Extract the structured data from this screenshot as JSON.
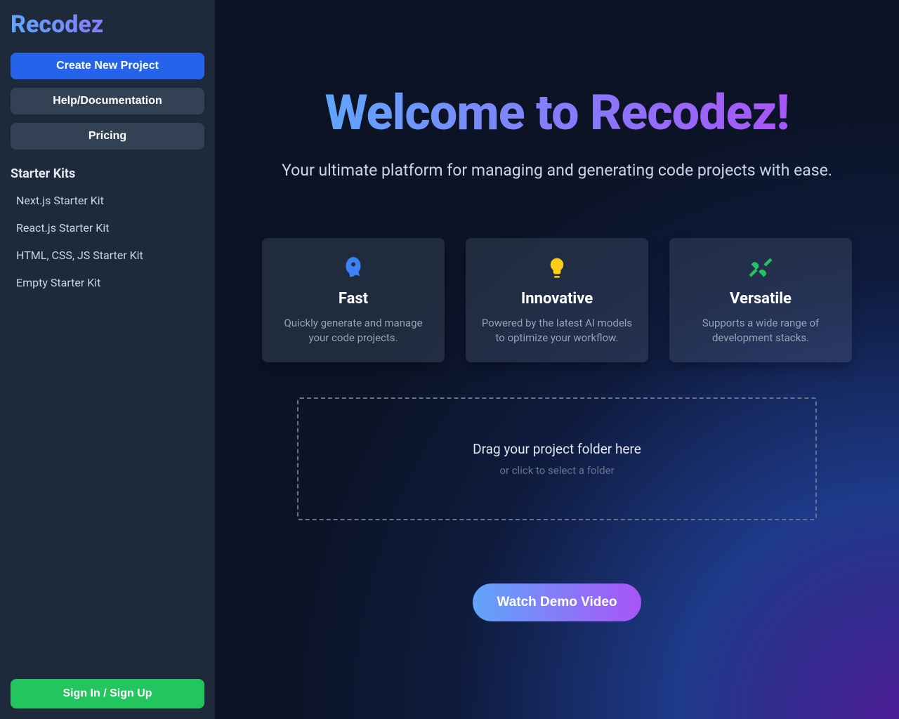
{
  "app": {
    "name": "Recodez"
  },
  "sidebar": {
    "create": "Create New Project",
    "help": "Help/Documentation",
    "pricing": "Pricing",
    "starter_title": "Starter Kits",
    "kits": [
      "Next.js Starter Kit",
      "React.js Starter Kit",
      "HTML, CSS, JS Starter Kit",
      "Empty Starter Kit"
    ],
    "signin": "Sign In / Sign Up"
  },
  "hero": {
    "title": "Welcome to Recodez!",
    "subtitle": "Your ultimate platform for managing and generating code projects with ease."
  },
  "features": [
    {
      "title": "Fast",
      "desc": "Quickly generate and manage your code projects.",
      "icon": "rocket-icon",
      "color": "#3b82f6"
    },
    {
      "title": "Innovative",
      "desc": "Powered by the latest AI models to optimize your workflow.",
      "icon": "lightbulb-icon",
      "color": "#facc15"
    },
    {
      "title": "Versatile",
      "desc": "Supports a wide range of development stacks.",
      "icon": "tools-icon",
      "color": "#22c55e"
    }
  ],
  "dropzone": {
    "main": "Drag your project folder here",
    "sub": "or click to select a folder"
  },
  "demo": {
    "label": "Watch Demo Video"
  }
}
